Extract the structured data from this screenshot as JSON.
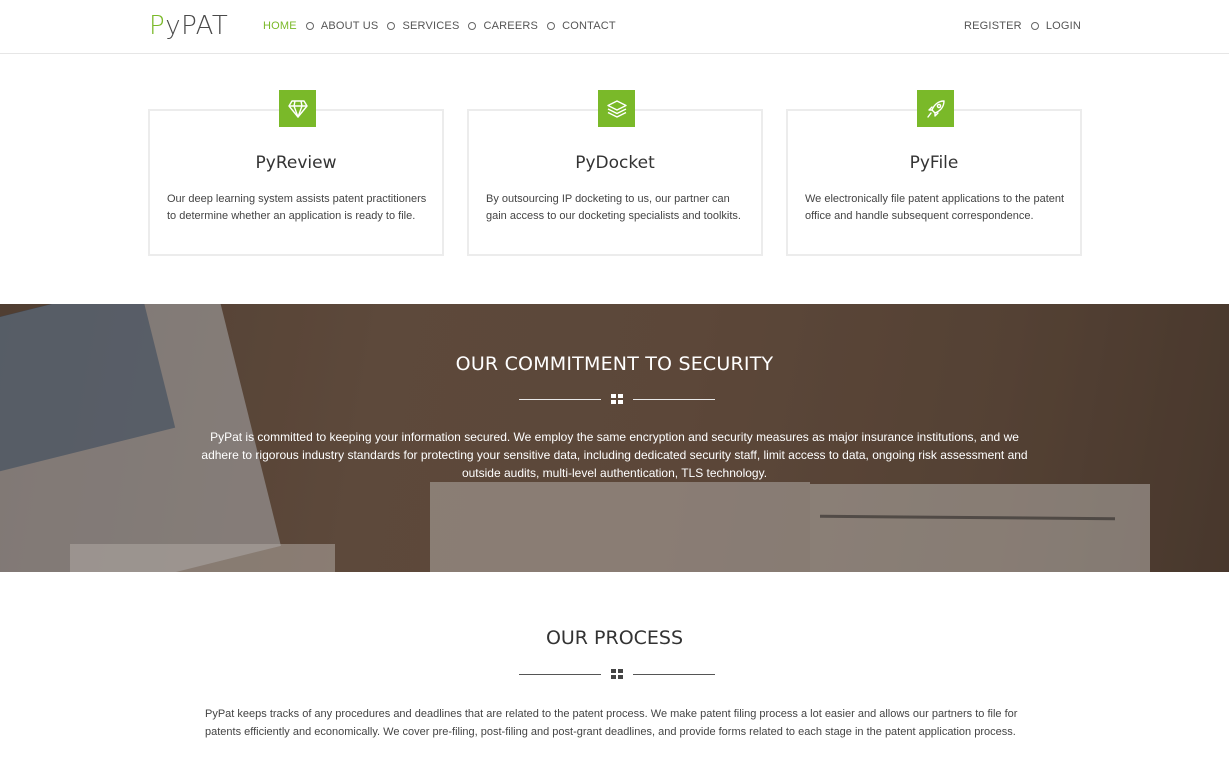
{
  "header": {
    "logo_accent": "P",
    "logo_rest": "yPAT",
    "nav": [
      {
        "label": "HOME",
        "active": true
      },
      {
        "label": "ABOUT US",
        "active": false
      },
      {
        "label": "SERVICES",
        "active": false
      },
      {
        "label": "CAREERS",
        "active": false
      },
      {
        "label": "CONTACT",
        "active": false
      }
    ],
    "register_label": "REGISTER",
    "login_label": "LOGIN"
  },
  "services": [
    {
      "icon": "diamond-icon",
      "title": "PyReview",
      "description": "Our deep learning system assists patent practitioners to determine whether an application is ready to file."
    },
    {
      "icon": "layers-icon",
      "title": "PyDocket",
      "description": "By outsourcing IP docketing to us, our partner can gain access to our docketing specialists and toolkits."
    },
    {
      "icon": "rocket-icon",
      "title": "PyFile",
      "description": "We electronically file patent applications to the patent office and handle subsequent correspondence."
    }
  ],
  "security": {
    "title": "OUR COMMITMENT TO SECURITY",
    "text": "PyPat is committed to keeping your information secured. We employ the same encryption and security measures as major insurance institutions, and we adhere to rigorous industry standards for protecting your sensitive data, including dedicated security staff, limit access to data, ongoing risk assessment and outside audits, multi-level authentication, TLS technology."
  },
  "process": {
    "title": "OUR PROCESS",
    "text": "PyPat keeps tracks of any procedures and deadlines that are related to the patent process. We make patent filing process a lot easier and allows our partners to file for patents efficiently and economically. We cover pre-filing, post-filing and post-grant deadlines, and provide forms related to each stage in the patent application process."
  },
  "colors": {
    "accent": "#7ab929",
    "text": "#333333"
  }
}
